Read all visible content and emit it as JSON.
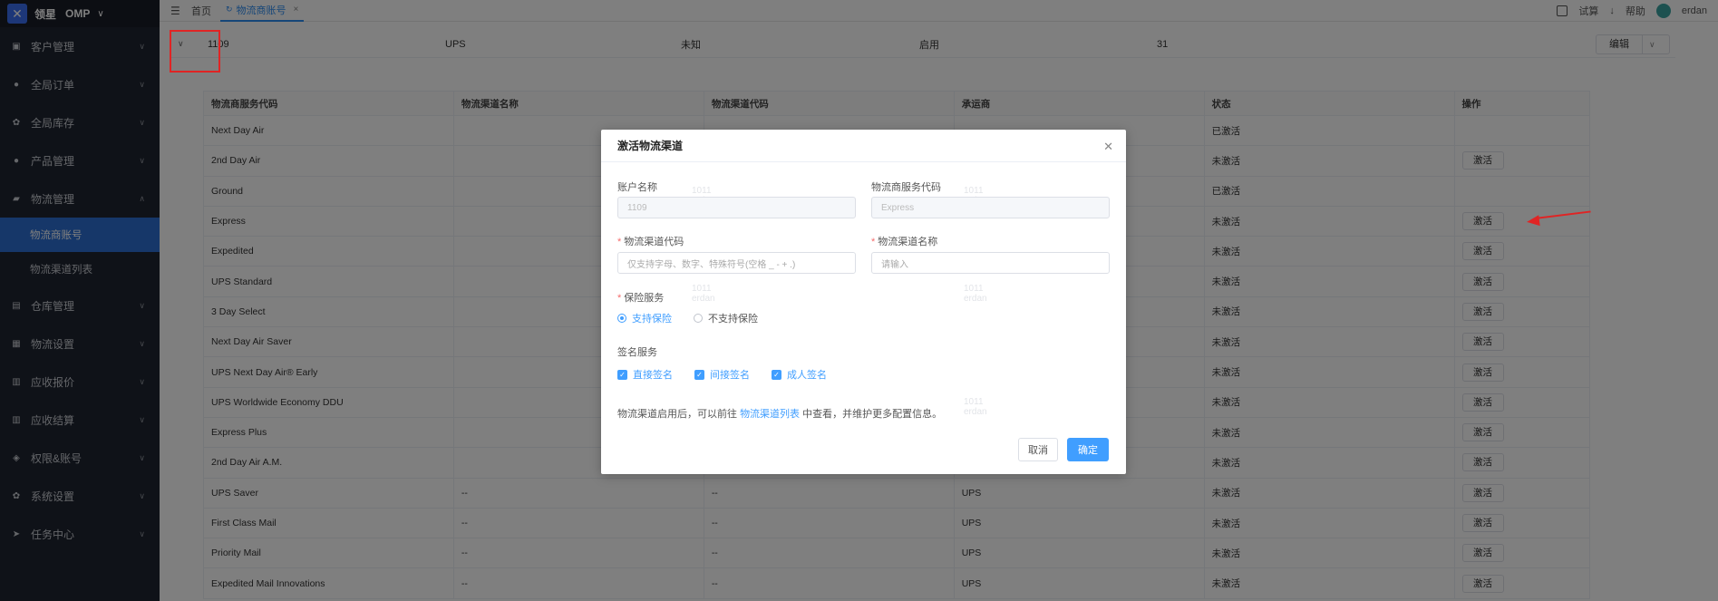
{
  "app": {
    "brand_name": "领星",
    "app_name": "OMP"
  },
  "sidebar": {
    "items": [
      {
        "label": "客户管理",
        "icon": "customer-icon"
      },
      {
        "label": "全局订单",
        "icon": "user-icon"
      },
      {
        "label": "全局库存",
        "icon": "gear-icon"
      },
      {
        "label": "产品管理",
        "icon": "user-icon"
      },
      {
        "label": "物流管理",
        "icon": "truck-icon"
      },
      {
        "label": "仓库管理",
        "icon": "warehouse-icon"
      },
      {
        "label": "物流设置",
        "icon": "settings-icon"
      },
      {
        "label": "应收报价",
        "icon": "document-icon"
      },
      {
        "label": "应收结算",
        "icon": "document-icon"
      },
      {
        "label": "权限&账号",
        "icon": "shield-icon"
      },
      {
        "label": "系统设置",
        "icon": "gear-icon"
      },
      {
        "label": "任务中心",
        "icon": "send-icon"
      }
    ],
    "sub_items": [
      {
        "label": "物流商账号",
        "active": true
      },
      {
        "label": "物流渠道列表",
        "active": false
      }
    ]
  },
  "topbar": {
    "home_tab": "首页",
    "active_tab": "物流商账号",
    "right": {
      "trial": "试算",
      "help": "帮助",
      "user": "erdan"
    }
  },
  "parent_row": {
    "account": "1109",
    "carrier": "UPS",
    "unknown": "未知",
    "status": "启用",
    "count": "31",
    "edit_label": "编辑"
  },
  "table": {
    "headers": [
      "物流商服务代码",
      "物流渠道名称",
      "物流渠道代码",
      "承运商",
      "状态",
      "操作"
    ],
    "rows": [
      {
        "code": "Next Day Air",
        "name": "",
        "channel": "",
        "carrier": "",
        "status": "已激活",
        "action": ""
      },
      {
        "code": "2nd Day Air",
        "name": "",
        "channel": "",
        "carrier": "",
        "status": "未激活",
        "action": "激活"
      },
      {
        "code": "Ground",
        "name": "",
        "channel": "",
        "carrier": "",
        "status": "已激活",
        "action": ""
      },
      {
        "code": "Express",
        "name": "",
        "channel": "",
        "carrier": "",
        "status": "未激活",
        "action": "激活"
      },
      {
        "code": "Expedited",
        "name": "",
        "channel": "",
        "carrier": "",
        "status": "未激活",
        "action": "激活"
      },
      {
        "code": "UPS Standard",
        "name": "",
        "channel": "",
        "carrier": "",
        "status": "未激活",
        "action": "激活"
      },
      {
        "code": "3 Day Select",
        "name": "",
        "channel": "",
        "carrier": "",
        "status": "未激活",
        "action": "激活"
      },
      {
        "code": "Next Day Air Saver",
        "name": "",
        "channel": "",
        "carrier": "",
        "status": "未激活",
        "action": "激活"
      },
      {
        "code": "UPS Next Day Air® Early",
        "name": "",
        "channel": "",
        "carrier": "",
        "status": "未激活",
        "action": "激活"
      },
      {
        "code": "UPS Worldwide Economy DDU",
        "name": "",
        "channel": "",
        "carrier": "",
        "status": "未激活",
        "action": "激活"
      },
      {
        "code": "Express Plus",
        "name": "",
        "channel": "",
        "carrier": "",
        "status": "未激活",
        "action": "激活"
      },
      {
        "code": "2nd Day Air A.M.",
        "name": "",
        "channel": "",
        "carrier": "",
        "status": "未激活",
        "action": "激活"
      },
      {
        "code": "UPS Saver",
        "name": "--",
        "channel": "--",
        "carrier": "UPS",
        "status": "未激活",
        "action": "激活"
      },
      {
        "code": "First Class Mail",
        "name": "--",
        "channel": "--",
        "carrier": "UPS",
        "status": "未激活",
        "action": "激活"
      },
      {
        "code": "Priority Mail",
        "name": "--",
        "channel": "--",
        "carrier": "UPS",
        "status": "未激活",
        "action": "激活"
      },
      {
        "code": "Expedited Mail Innovations",
        "name": "--",
        "channel": "--",
        "carrier": "UPS",
        "status": "未激活",
        "action": "激活"
      }
    ]
  },
  "dialog": {
    "title": "激活物流渠道",
    "account_label": "账户名称",
    "account_value": "1109",
    "service_code_label": "物流商服务代码",
    "service_code_value": "Express",
    "channel_code_label": "物流渠道代码",
    "channel_code_placeholder": "仅支持字母、数字、特殊符号(空格 _ - + .)",
    "channel_name_label": "物流渠道名称",
    "channel_name_placeholder": "请输入",
    "insurance_label": "保险服务",
    "insurance_options": [
      "支持保险",
      "不支持保险"
    ],
    "signature_label": "签名服务",
    "signature_options": [
      "直接签名",
      "间接签名",
      "成人签名"
    ],
    "note_prefix": "物流渠道启用后，可以前往",
    "note_link": "物流渠道列表",
    "note_suffix": "中查看，并维护更多配置信息。",
    "cancel_label": "取消",
    "ok_label": "确定"
  },
  "watermark": {
    "line1": "1011",
    "line2": "erdan"
  },
  "colors": {
    "primary": "#409eff",
    "sidebar_bg": "#1f2430",
    "active_menu": "#2d6fd2",
    "annotation": "#e02424"
  }
}
